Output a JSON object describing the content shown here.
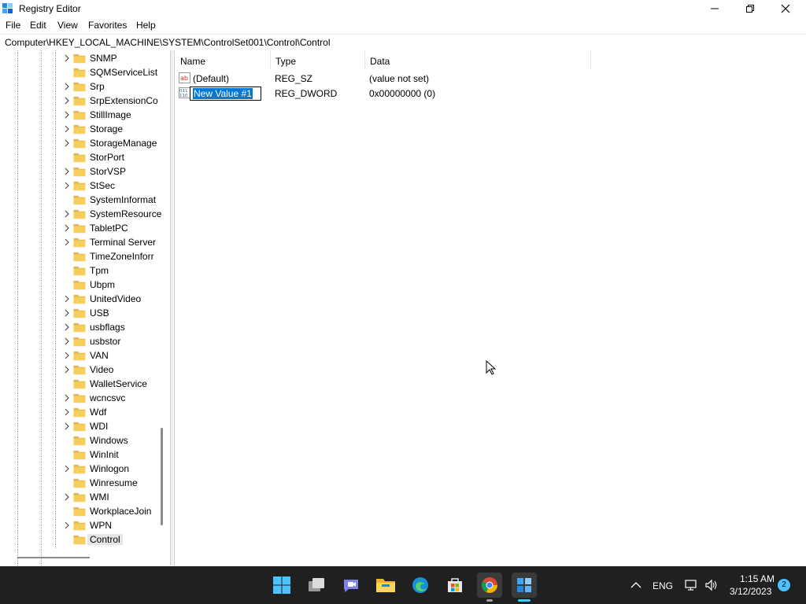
{
  "window": {
    "title": "Registry Editor"
  },
  "menu": [
    "File",
    "Edit",
    "View",
    "Favorites",
    "Help"
  ],
  "address": "Computer\\HKEY_LOCAL_MACHINE\\SYSTEM\\ControlSet001\\Control\\Control",
  "tree": {
    "items": [
      {
        "label": "SNMP",
        "expandable": true
      },
      {
        "label": "SQMServiceList",
        "expandable": false
      },
      {
        "label": "Srp",
        "expandable": true
      },
      {
        "label": "SrpExtensionCo",
        "expandable": true
      },
      {
        "label": "StillImage",
        "expandable": true
      },
      {
        "label": "Storage",
        "expandable": true
      },
      {
        "label": "StorageManage",
        "expandable": true
      },
      {
        "label": "StorPort",
        "expandable": false
      },
      {
        "label": "StorVSP",
        "expandable": true
      },
      {
        "label": "StSec",
        "expandable": true
      },
      {
        "label": "SystemInformat",
        "expandable": false
      },
      {
        "label": "SystemResource",
        "expandable": true
      },
      {
        "label": "TabletPC",
        "expandable": true
      },
      {
        "label": "Terminal Server",
        "expandable": true
      },
      {
        "label": "TimeZoneInforr",
        "expandable": false
      },
      {
        "label": "Tpm",
        "expandable": false
      },
      {
        "label": "Ubpm",
        "expandable": false
      },
      {
        "label": "UnitedVideo",
        "expandable": true
      },
      {
        "label": "USB",
        "expandable": true
      },
      {
        "label": "usbflags",
        "expandable": true
      },
      {
        "label": "usbstor",
        "expandable": true
      },
      {
        "label": "VAN",
        "expandable": true
      },
      {
        "label": "Video",
        "expandable": true
      },
      {
        "label": "WalletService",
        "expandable": false
      },
      {
        "label": "wcncsvc",
        "expandable": true
      },
      {
        "label": "Wdf",
        "expandable": true
      },
      {
        "label": "WDI",
        "expandable": true
      },
      {
        "label": "Windows",
        "expandable": false
      },
      {
        "label": "WinInit",
        "expandable": false
      },
      {
        "label": "Winlogon",
        "expandable": true
      },
      {
        "label": "Winresume",
        "expandable": false
      },
      {
        "label": "WMI",
        "expandable": true
      },
      {
        "label": "WorkplaceJoin",
        "expandable": false
      },
      {
        "label": "WPN",
        "expandable": true
      },
      {
        "label": "Control",
        "expandable": false,
        "selected": true
      }
    ]
  },
  "list": {
    "columns": [
      "Name",
      "Type",
      "Data"
    ],
    "rows": [
      {
        "icon": "string-value-icon",
        "name": "(Default)",
        "type": "REG_SZ",
        "data": "(value not set)"
      },
      {
        "icon": "dword-value-icon",
        "name": "New Value #1",
        "type": "REG_DWORD",
        "data": "0x00000000 (0)",
        "editing": true
      }
    ]
  },
  "taskbar": {
    "language": "ENG",
    "time": "1:15 AM",
    "date": "3/12/2023",
    "notification_count": "2"
  }
}
